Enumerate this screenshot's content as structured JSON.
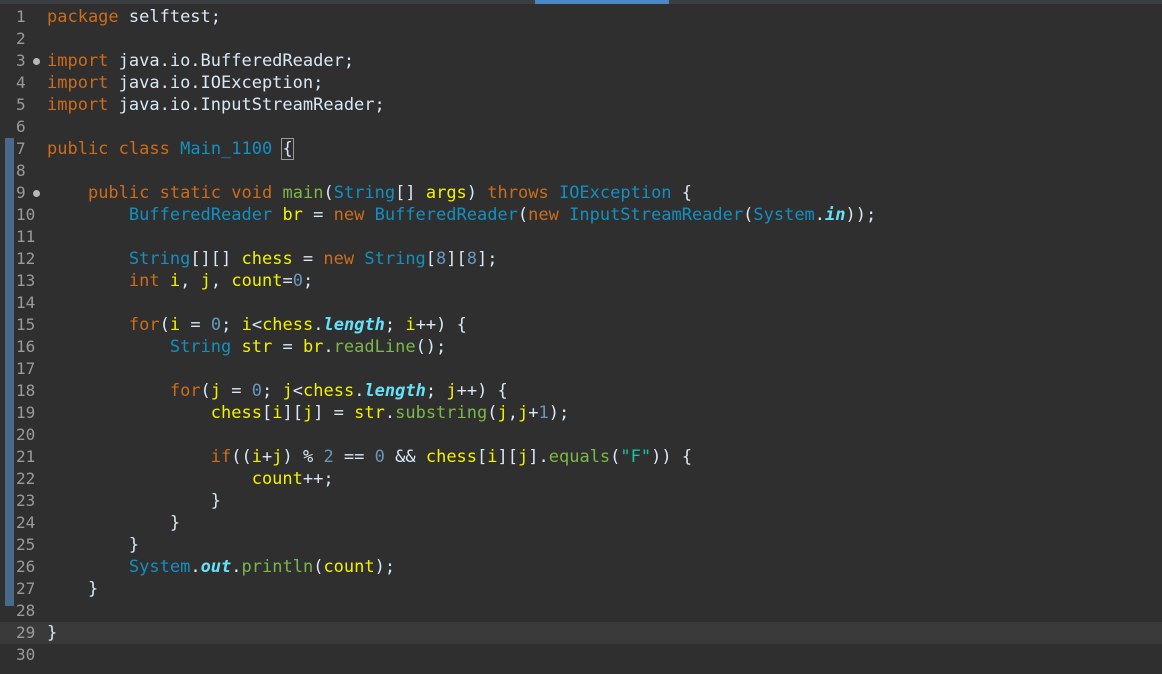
{
  "editor": {
    "lines": [
      {
        "n": "1",
        "tokens": [
          {
            "t": "package",
            "c": "kw"
          },
          {
            "t": " selftest;",
            "c": ""
          }
        ]
      },
      {
        "n": "2",
        "tokens": []
      },
      {
        "n": "3",
        "fold": true,
        "tokens": [
          {
            "t": "import",
            "c": "kw"
          },
          {
            "t": " java.io.BufferedReader;",
            "c": ""
          }
        ]
      },
      {
        "n": "4",
        "tokens": [
          {
            "t": "import",
            "c": "kw"
          },
          {
            "t": " java.io.IOException;",
            "c": ""
          }
        ]
      },
      {
        "n": "5",
        "tokens": [
          {
            "t": "import",
            "c": "kw"
          },
          {
            "t": " java.io.InputStreamReader;",
            "c": ""
          }
        ]
      },
      {
        "n": "6",
        "tokens": []
      },
      {
        "n": "7",
        "tokens": [
          {
            "t": "public",
            "c": "kw"
          },
          {
            "t": " ",
            "c": ""
          },
          {
            "t": "class",
            "c": "kw"
          },
          {
            "t": " ",
            "c": ""
          },
          {
            "t": "Main_1100",
            "c": "type"
          },
          {
            "t": " ",
            "c": ""
          },
          {
            "t": "{",
            "c": "caret"
          }
        ]
      },
      {
        "n": "8",
        "tokens": []
      },
      {
        "n": "9",
        "fold": true,
        "tokens": [
          {
            "t": "    ",
            "c": ""
          },
          {
            "t": "public",
            "c": "kw"
          },
          {
            "t": " ",
            "c": ""
          },
          {
            "t": "static",
            "c": "kw"
          },
          {
            "t": " ",
            "c": ""
          },
          {
            "t": "void",
            "c": "kw"
          },
          {
            "t": " ",
            "c": ""
          },
          {
            "t": "main",
            "c": "method"
          },
          {
            "t": "(",
            "c": ""
          },
          {
            "t": "String",
            "c": "type"
          },
          {
            "t": "[] ",
            "c": ""
          },
          {
            "t": "args",
            "c": "var"
          },
          {
            "t": ") ",
            "c": ""
          },
          {
            "t": "throws",
            "c": "kw"
          },
          {
            "t": " ",
            "c": ""
          },
          {
            "t": "IOException",
            "c": "type"
          },
          {
            "t": " {",
            "c": ""
          }
        ]
      },
      {
        "n": "10",
        "tokens": [
          {
            "t": "        ",
            "c": ""
          },
          {
            "t": "BufferedReader",
            "c": "type"
          },
          {
            "t": " ",
            "c": ""
          },
          {
            "t": "br",
            "c": "var"
          },
          {
            "t": " = ",
            "c": ""
          },
          {
            "t": "new",
            "c": "kw"
          },
          {
            "t": " ",
            "c": ""
          },
          {
            "t": "BufferedReader",
            "c": "type"
          },
          {
            "t": "(",
            "c": ""
          },
          {
            "t": "new",
            "c": "kw"
          },
          {
            "t": " ",
            "c": ""
          },
          {
            "t": "InputStreamReader",
            "c": "type"
          },
          {
            "t": "(",
            "c": ""
          },
          {
            "t": "System",
            "c": "type"
          },
          {
            "t": ".",
            "c": ""
          },
          {
            "t": "in",
            "c": "field"
          },
          {
            "t": "));",
            "c": ""
          }
        ]
      },
      {
        "n": "11",
        "tokens": []
      },
      {
        "n": "12",
        "tokens": [
          {
            "t": "        ",
            "c": ""
          },
          {
            "t": "String",
            "c": "type"
          },
          {
            "t": "[][] ",
            "c": ""
          },
          {
            "t": "chess",
            "c": "var"
          },
          {
            "t": " = ",
            "c": ""
          },
          {
            "t": "new",
            "c": "kw"
          },
          {
            "t": " ",
            "c": ""
          },
          {
            "t": "String",
            "c": "type"
          },
          {
            "t": "[",
            "c": ""
          },
          {
            "t": "8",
            "c": "num"
          },
          {
            "t": "][",
            "c": ""
          },
          {
            "t": "8",
            "c": "num"
          },
          {
            "t": "];",
            "c": ""
          }
        ]
      },
      {
        "n": "13",
        "tokens": [
          {
            "t": "        ",
            "c": ""
          },
          {
            "t": "int",
            "c": "kw"
          },
          {
            "t": " ",
            "c": ""
          },
          {
            "t": "i",
            "c": "var"
          },
          {
            "t": ", ",
            "c": ""
          },
          {
            "t": "j",
            "c": "var"
          },
          {
            "t": ", ",
            "c": ""
          },
          {
            "t": "count",
            "c": "var"
          },
          {
            "t": "=",
            "c": ""
          },
          {
            "t": "0",
            "c": "num"
          },
          {
            "t": ";",
            "c": ""
          }
        ]
      },
      {
        "n": "14",
        "tokens": []
      },
      {
        "n": "15",
        "tokens": [
          {
            "t": "        ",
            "c": ""
          },
          {
            "t": "for",
            "c": "kw"
          },
          {
            "t": "(",
            "c": ""
          },
          {
            "t": "i",
            "c": "var"
          },
          {
            "t": " = ",
            "c": ""
          },
          {
            "t": "0",
            "c": "num"
          },
          {
            "t": "; ",
            "c": ""
          },
          {
            "t": "i",
            "c": "var"
          },
          {
            "t": "<",
            "c": ""
          },
          {
            "t": "chess",
            "c": "var"
          },
          {
            "t": ".",
            "c": ""
          },
          {
            "t": "length",
            "c": "field"
          },
          {
            "t": "; ",
            "c": ""
          },
          {
            "t": "i",
            "c": "var"
          },
          {
            "t": "++) {",
            "c": ""
          }
        ]
      },
      {
        "n": "16",
        "tokens": [
          {
            "t": "            ",
            "c": ""
          },
          {
            "t": "String",
            "c": "type"
          },
          {
            "t": " ",
            "c": ""
          },
          {
            "t": "str",
            "c": "var"
          },
          {
            "t": " = ",
            "c": ""
          },
          {
            "t": "br",
            "c": "var"
          },
          {
            "t": ".",
            "c": ""
          },
          {
            "t": "readLine",
            "c": "method"
          },
          {
            "t": "();",
            "c": ""
          }
        ]
      },
      {
        "n": "17",
        "tokens": []
      },
      {
        "n": "18",
        "tokens": [
          {
            "t": "            ",
            "c": ""
          },
          {
            "t": "for",
            "c": "kw"
          },
          {
            "t": "(",
            "c": ""
          },
          {
            "t": "j",
            "c": "var"
          },
          {
            "t": " = ",
            "c": ""
          },
          {
            "t": "0",
            "c": "num"
          },
          {
            "t": "; ",
            "c": ""
          },
          {
            "t": "j",
            "c": "var"
          },
          {
            "t": "<",
            "c": ""
          },
          {
            "t": "chess",
            "c": "var"
          },
          {
            "t": ".",
            "c": ""
          },
          {
            "t": "length",
            "c": "field"
          },
          {
            "t": "; ",
            "c": ""
          },
          {
            "t": "j",
            "c": "var"
          },
          {
            "t": "++) {",
            "c": ""
          }
        ]
      },
      {
        "n": "19",
        "tokens": [
          {
            "t": "                ",
            "c": ""
          },
          {
            "t": "chess",
            "c": "var"
          },
          {
            "t": "[",
            "c": ""
          },
          {
            "t": "i",
            "c": "var"
          },
          {
            "t": "][",
            "c": ""
          },
          {
            "t": "j",
            "c": "var"
          },
          {
            "t": "] = ",
            "c": ""
          },
          {
            "t": "str",
            "c": "var"
          },
          {
            "t": ".",
            "c": ""
          },
          {
            "t": "substring",
            "c": "method"
          },
          {
            "t": "(",
            "c": ""
          },
          {
            "t": "j",
            "c": "var"
          },
          {
            "t": ",",
            "c": ""
          },
          {
            "t": "j",
            "c": "var"
          },
          {
            "t": "+",
            "c": ""
          },
          {
            "t": "1",
            "c": "num"
          },
          {
            "t": ");",
            "c": ""
          }
        ]
      },
      {
        "n": "20",
        "tokens": []
      },
      {
        "n": "21",
        "tokens": [
          {
            "t": "                ",
            "c": ""
          },
          {
            "t": "if",
            "c": "kw"
          },
          {
            "t": "((",
            "c": ""
          },
          {
            "t": "i",
            "c": "var"
          },
          {
            "t": "+",
            "c": ""
          },
          {
            "t": "j",
            "c": "var"
          },
          {
            "t": ") % ",
            "c": ""
          },
          {
            "t": "2",
            "c": "num"
          },
          {
            "t": " == ",
            "c": ""
          },
          {
            "t": "0",
            "c": "num"
          },
          {
            "t": " && ",
            "c": ""
          },
          {
            "t": "chess",
            "c": "var"
          },
          {
            "t": "[",
            "c": ""
          },
          {
            "t": "i",
            "c": "var"
          },
          {
            "t": "][",
            "c": ""
          },
          {
            "t": "j",
            "c": "var"
          },
          {
            "t": "].",
            "c": ""
          },
          {
            "t": "equals",
            "c": "method"
          },
          {
            "t": "(",
            "c": ""
          },
          {
            "t": "\"F\"",
            "c": "str"
          },
          {
            "t": ")) {",
            "c": ""
          }
        ]
      },
      {
        "n": "22",
        "tokens": [
          {
            "t": "                    ",
            "c": ""
          },
          {
            "t": "count",
            "c": "var"
          },
          {
            "t": "++;",
            "c": ""
          }
        ]
      },
      {
        "n": "23",
        "tokens": [
          {
            "t": "                }",
            "c": ""
          }
        ]
      },
      {
        "n": "24",
        "tokens": [
          {
            "t": "            }",
            "c": ""
          }
        ]
      },
      {
        "n": "25",
        "tokens": [
          {
            "t": "        }",
            "c": ""
          }
        ]
      },
      {
        "n": "26",
        "tokens": [
          {
            "t": "        ",
            "c": ""
          },
          {
            "t": "System",
            "c": "type"
          },
          {
            "t": ".",
            "c": ""
          },
          {
            "t": "out",
            "c": "field"
          },
          {
            "t": ".",
            "c": ""
          },
          {
            "t": "println",
            "c": "method"
          },
          {
            "t": "(",
            "c": ""
          },
          {
            "t": "count",
            "c": "var"
          },
          {
            "t": ");",
            "c": ""
          }
        ]
      },
      {
        "n": "27",
        "tokens": [
          {
            "t": "    }",
            "c": ""
          }
        ]
      },
      {
        "n": "28",
        "tokens": []
      },
      {
        "n": "29",
        "current": true,
        "tokens": [
          {
            "t": "}",
            "c": ""
          }
        ]
      },
      {
        "n": "30",
        "tokens": []
      }
    ]
  }
}
